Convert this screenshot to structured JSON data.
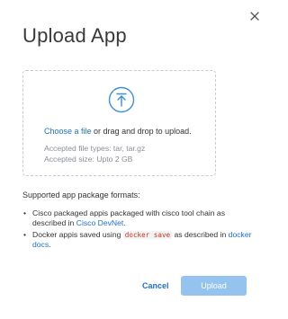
{
  "dialog": {
    "title": "Upload App",
    "close_icon": "close-icon"
  },
  "dropzone": {
    "icon": "upload-arrow-icon",
    "choose_link": "Choose a file",
    "drop_text": " or drag and drop to upload.",
    "accepted_types": "Accepted file types: tar, tar.gz",
    "accepted_size": "Accepted size: Upto 2 GB"
  },
  "formats": {
    "heading": "Supported app package formats:",
    "items": [
      {
        "text_before": "Cisco packaged appis packaged with cisco tool chain as described in ",
        "link": "Cisco DevNet",
        "text_after": "."
      },
      {
        "text_before": "Docker appis saved using ",
        "code": "docker save",
        "text_middle": " as described in ",
        "link": "docker docs",
        "text_after": "."
      }
    ]
  },
  "footer": {
    "cancel_label": "Cancel",
    "upload_label": "Upload"
  },
  "colors": {
    "link": "#1e6fc8",
    "upload_button_disabled": "#93c3ee",
    "dropzone_border": "#c6cbd1",
    "icon": "#3d8fd6"
  }
}
